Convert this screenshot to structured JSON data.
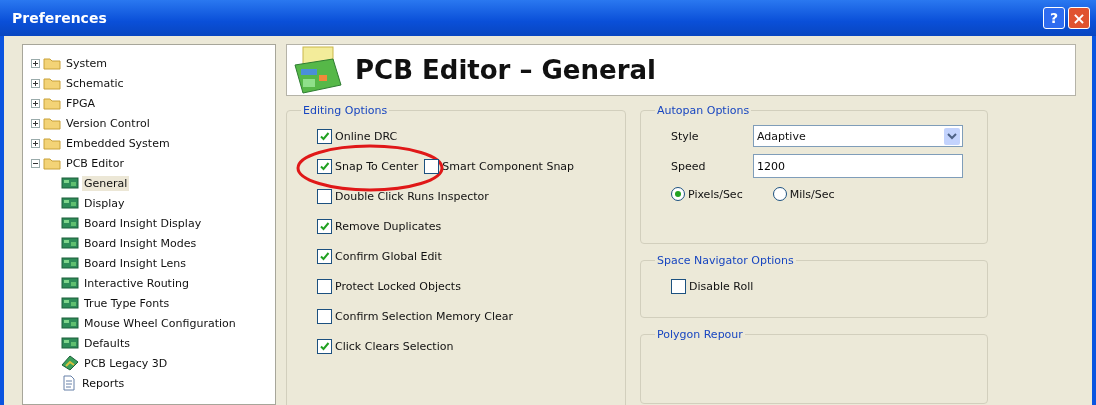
{
  "window": {
    "title": "Preferences",
    "buttons": [
      {
        "kind": "help",
        "label": "?"
      },
      {
        "kind": "close",
        "label": "×"
      }
    ]
  },
  "tree": [
    {
      "label": "System",
      "kind": "folder",
      "expanded": false,
      "selected": false
    },
    {
      "label": "Schematic",
      "kind": "folder",
      "expanded": false,
      "selected": false
    },
    {
      "label": "FPGA",
      "kind": "folder",
      "expanded": false,
      "selected": false
    },
    {
      "label": "Version Control",
      "kind": "folder",
      "expanded": false,
      "selected": false
    },
    {
      "label": "Embedded System",
      "kind": "folder",
      "expanded": false,
      "selected": false
    },
    {
      "label": "PCB Editor",
      "kind": "folder",
      "expanded": true,
      "selected": false,
      "children": [
        {
          "label": "General",
          "kind": "board",
          "selected": true
        },
        {
          "label": "Display",
          "kind": "board",
          "selected": false
        },
        {
          "label": "Board Insight Display",
          "kind": "board",
          "selected": false
        },
        {
          "label": "Board Insight Modes",
          "kind": "board",
          "selected": false
        },
        {
          "label": "Board Insight Lens",
          "kind": "board",
          "selected": false
        },
        {
          "label": "Interactive Routing",
          "kind": "board",
          "selected": false
        },
        {
          "label": "True Type Fonts",
          "kind": "board",
          "selected": false
        },
        {
          "label": "Mouse Wheel Configuration",
          "kind": "board",
          "selected": false
        },
        {
          "label": "Defaults",
          "kind": "board",
          "selected": false
        },
        {
          "label": "PCB Legacy 3D",
          "kind": "model",
          "selected": false
        },
        {
          "label": "Reports",
          "kind": "report",
          "selected": false
        }
      ]
    }
  ],
  "page": {
    "title": "PCB Editor – General"
  },
  "editing_options": {
    "title": "Editing Options",
    "rows": [
      [
        {
          "label": "Online DRC",
          "checked": true
        }
      ],
      [
        {
          "label": "Snap To Center",
          "checked": true,
          "circled": true
        },
        {
          "label": "Smart Component Snap",
          "checked": false
        }
      ],
      [
        {
          "label": "Double Click Runs Inspector",
          "checked": false
        }
      ],
      [
        {
          "label": "Remove Duplicates",
          "checked": true
        }
      ],
      [
        {
          "label": "Confirm Global Edit",
          "checked": true
        }
      ],
      [
        {
          "label": "Protect Locked Objects",
          "checked": false
        }
      ],
      [
        {
          "label": "Confirm Selection Memory Clear",
          "checked": false
        }
      ],
      [
        {
          "label": "Click Clears Selection",
          "checked": true
        }
      ]
    ]
  },
  "autopan": {
    "title": "Autopan Options",
    "style_label": "Style",
    "style_value": "Adaptive",
    "speed_label": "Speed",
    "speed_value": "1200",
    "units": [
      {
        "label": "Pixels/Sec",
        "selected": true
      },
      {
        "label": "Mils/Sec",
        "selected": false
      }
    ]
  },
  "space_navigator": {
    "title": "Space Navigator Options",
    "options": [
      {
        "label": "Disable Roll",
        "checked": false
      }
    ]
  },
  "polygon_repour": {
    "title": "Polygon Repour"
  }
}
